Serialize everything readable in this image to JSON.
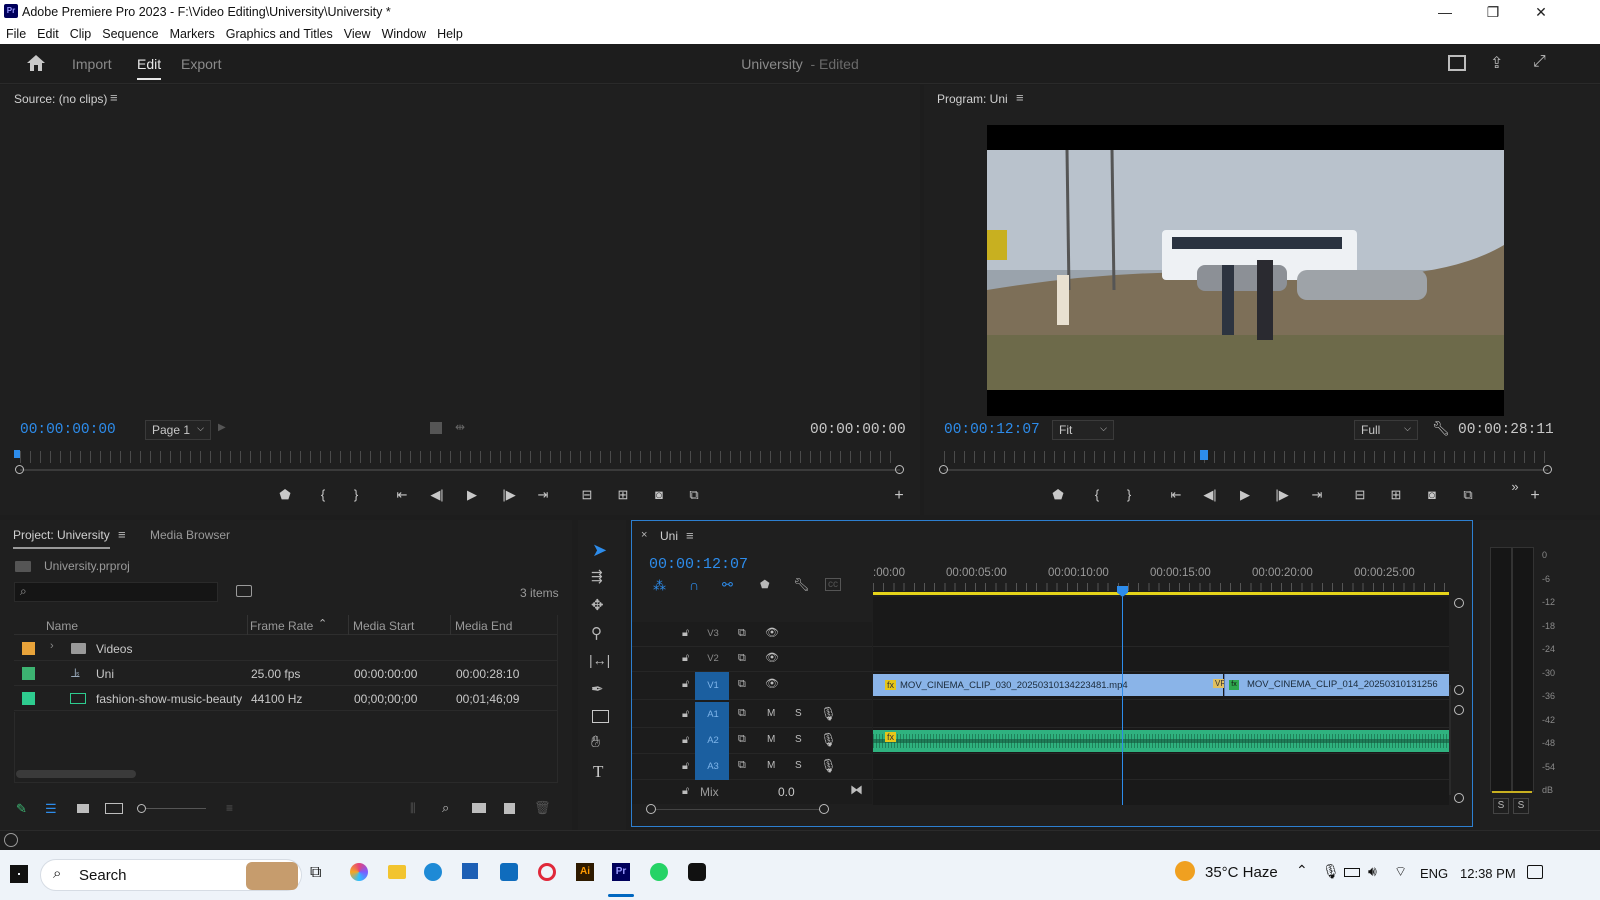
{
  "window": {
    "app_icon": "Pr",
    "title": "Adobe Premiere Pro 2023 - F:\\Video Editing\\University\\University *",
    "minimize": "—",
    "maximize": "❐",
    "close": "✕"
  },
  "menu": [
    "File",
    "Edit",
    "Clip",
    "Sequence",
    "Markers",
    "Graphics and Titles",
    "View",
    "Window",
    "Help"
  ],
  "header": {
    "tabs": [
      "Import",
      "Edit",
      "Export"
    ],
    "active_tab": "Edit",
    "project_name": "University",
    "project_status": "- Edited"
  },
  "source": {
    "title": "Source: (no clips)",
    "timecode_in": "00:00:00:00",
    "page_select": "Page 1",
    "timecode_out": "00:00:00:00"
  },
  "program": {
    "title": "Program: Uni",
    "timecode_in": "00:00:12:07",
    "fit_select": "Fit",
    "quality_select": "Full",
    "timecode_out": "00:00:28:11",
    "playhead_fraction": 0.43
  },
  "project": {
    "tabs": [
      "Project: University",
      "Media Browser"
    ],
    "file": "University.prproj",
    "items_count": "3 items",
    "columns": [
      "Name",
      "Frame Rate",
      "Media Start",
      "Media End"
    ],
    "rows": [
      {
        "name": "Videos",
        "frame_rate": "",
        "media_start": "",
        "media_end": "",
        "color": "#e8a33a",
        "kind": "folder"
      },
      {
        "name": "Uni",
        "frame_rate": "25.00 fps",
        "media_start": "00:00:00:00",
        "media_end": "00:00:28:10",
        "color": "#3cb371",
        "kind": "sequence"
      },
      {
        "name": "fashion-show-music-beauty",
        "frame_rate": "44100 Hz",
        "media_start": "00;00;00;00",
        "media_end": "00;01;46;09",
        "color": "#2ecc8f",
        "kind": "audio"
      }
    ]
  },
  "timeline": {
    "tab": "Uni",
    "timecode": "00:00:12:07",
    "ruler_labels": [
      ":00:00",
      "00:00:05:00",
      "00:00:10:00",
      "00:00:15:00",
      "00:00:20:00",
      "00:00:25:00"
    ],
    "video_tracks": [
      "V3",
      "V2",
      "V1"
    ],
    "audio_tracks": [
      "A1",
      "A2",
      "A3"
    ],
    "mix_label": "Mix",
    "mix_value": "0.0",
    "clips": [
      {
        "name": "MOV_CINEMA_CLIP_030_20250310134223481.mp4"
      },
      {
        "name": "MOV_CINEMA_CLIP_014_20250310131256"
      }
    ],
    "fx_badge": "fx",
    "vr_badge": "VR"
  },
  "meter": {
    "scale": [
      "0",
      "-6",
      "-12",
      "-18",
      "-24",
      "-30",
      "-36",
      "-42",
      "-48",
      "-54",
      "dB"
    ],
    "solo_left": "S",
    "solo_right": "S"
  },
  "taskbar": {
    "search": "Search",
    "weather": "35°C  Haze",
    "language": "ENG",
    "time": "12:38 PM"
  }
}
